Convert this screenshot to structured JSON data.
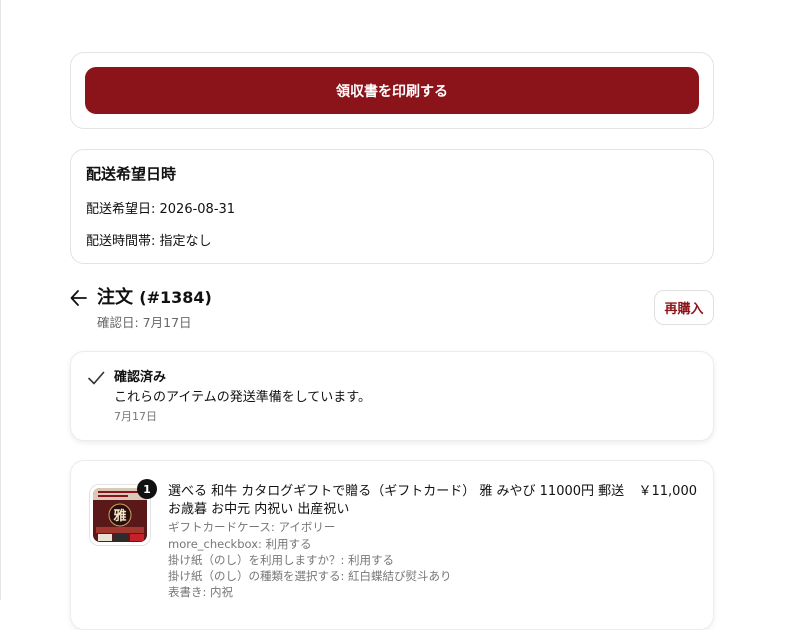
{
  "print": {
    "label": "領収書を印刷する"
  },
  "delivery": {
    "title": "配送希望日時",
    "date_line": "配送希望日: 2026-08-31",
    "time_line": "配送時間帯: 指定なし"
  },
  "order": {
    "title": "注文",
    "number": "(#1384)",
    "confirmed": "確認日: 7月17日",
    "rebuy_label": "再購入"
  },
  "status": {
    "title": "確認済み",
    "message": "これらのアイテムの発送準備をしています。",
    "date": "7月17日"
  },
  "item": {
    "quantity": "1",
    "title": "選べる 和牛 カタログギフトで贈る（ギフトカード） 雅 みやび 11000円 郵送 お歳暮 お中元 内祝い 出産祝い",
    "price": "￥11,000",
    "options": [
      "ギフトカードケース: アイボリー",
      "more_checkbox: 利用する",
      "掛け紙（のし）を利用しますか？: 利用する",
      "掛け紙（のし）の種類を選択する: 紅白蝶結び熨斗あり",
      "表書き: 内祝"
    ],
    "thumb_text": "雅"
  },
  "colors": {
    "accent": "#8b141a",
    "text": "#111111",
    "muted": "#777777"
  }
}
